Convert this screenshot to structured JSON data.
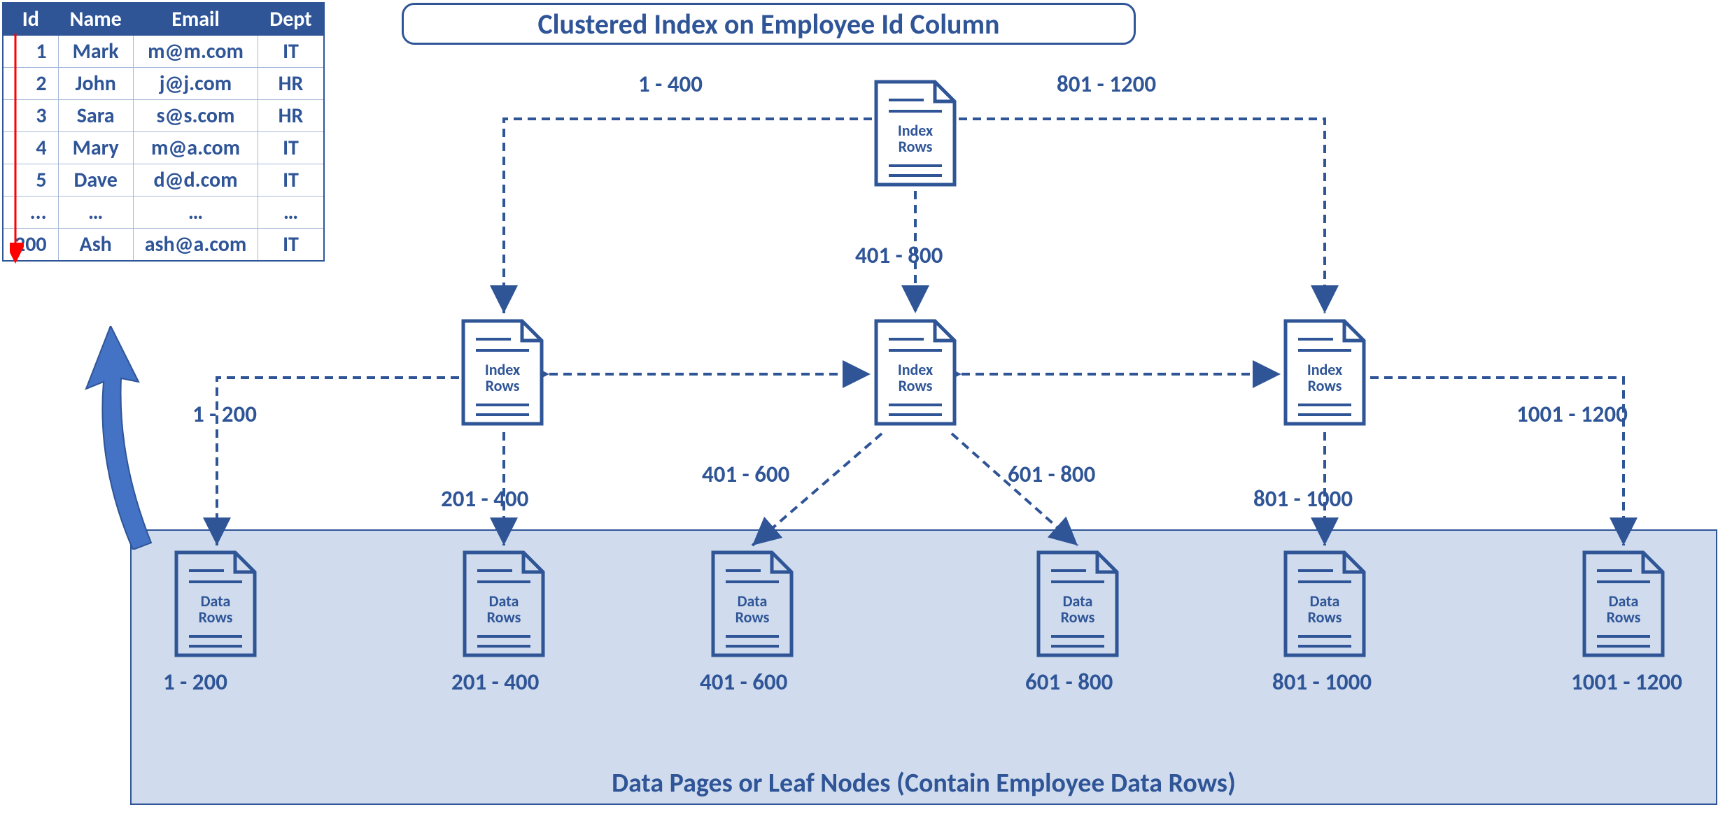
{
  "title": "Clustered Index on Employee Id Column",
  "table": {
    "headers": [
      "Id",
      "Name",
      "Email",
      "Dept"
    ],
    "rows": [
      [
        "1",
        "Mark",
        "m@m.com",
        "IT"
      ],
      [
        "2",
        "John",
        "j@j.com",
        "HR"
      ],
      [
        "3",
        "Sara",
        "s@s.com",
        "HR"
      ],
      [
        "4",
        "Mary",
        "m@a.com",
        "IT"
      ],
      [
        "5",
        "Dave",
        "d@d.com",
        "IT"
      ],
      [
        "...",
        "…",
        "…",
        "…"
      ],
      [
        "200",
        "Ash",
        "ash@a.com",
        "IT"
      ]
    ]
  },
  "root": {
    "label1": "Index",
    "label2": "Rows"
  },
  "root_ranges": {
    "left": "1 - 400",
    "mid": "401 - 800",
    "right": "801 - 1200"
  },
  "mid_nodes": [
    {
      "label1": "Index",
      "label2": "Rows"
    },
    {
      "label1": "Index",
      "label2": "Rows"
    },
    {
      "label1": "Index",
      "label2": "Rows"
    }
  ],
  "mid_edge_labels": {
    "l1": "1 - 200",
    "l2": "201 - 400",
    "m1": "401 - 600",
    "m2": "601 - 800",
    "r1": "801 - 1000",
    "r2": "1001 - 1200"
  },
  "leaf_nodes": [
    {
      "label1": "Data",
      "label2": "Rows",
      "range": "1 - 200"
    },
    {
      "label1": "Data",
      "label2": "Rows",
      "range": "201 - 400"
    },
    {
      "label1": "Data",
      "label2": "Rows",
      "range": "401 - 600"
    },
    {
      "label1": "Data",
      "label2": "Rows",
      "range": "601 - 800"
    },
    {
      "label1": "Data",
      "label2": "Rows",
      "range": "801 - 1000"
    },
    {
      "label1": "Data",
      "label2": "Rows",
      "range": "1001 - 1200"
    }
  ],
  "leaf_caption": "Data Pages or Leaf Nodes (Contain Employee Data Rows)"
}
